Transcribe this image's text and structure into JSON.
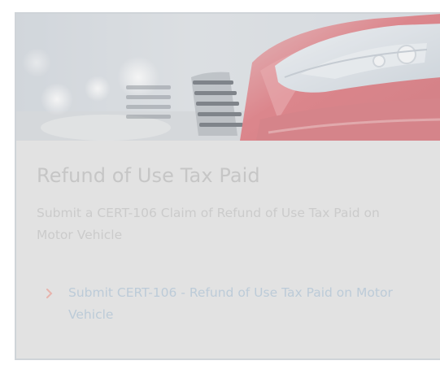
{
  "card": {
    "hero_image_icon": "car-headlight-photo",
    "title": "Refund of Use Tax Paid",
    "description": "Submit a CERT-106 Claim of Refund of Use Tax Paid on Motor Vehicle",
    "link": {
      "icon": "chevron-right-icon",
      "label": "Submit CERT-106 - Refund of Use Tax Paid on Motor Vehicle"
    }
  },
  "colors": {
    "card_background": "#e2e2e2",
    "title": "#c6c6c6",
    "description": "#cbcbcb",
    "link": "#bccbd8",
    "chevron": "#e7b4ad",
    "car_red": "#d85a63"
  }
}
